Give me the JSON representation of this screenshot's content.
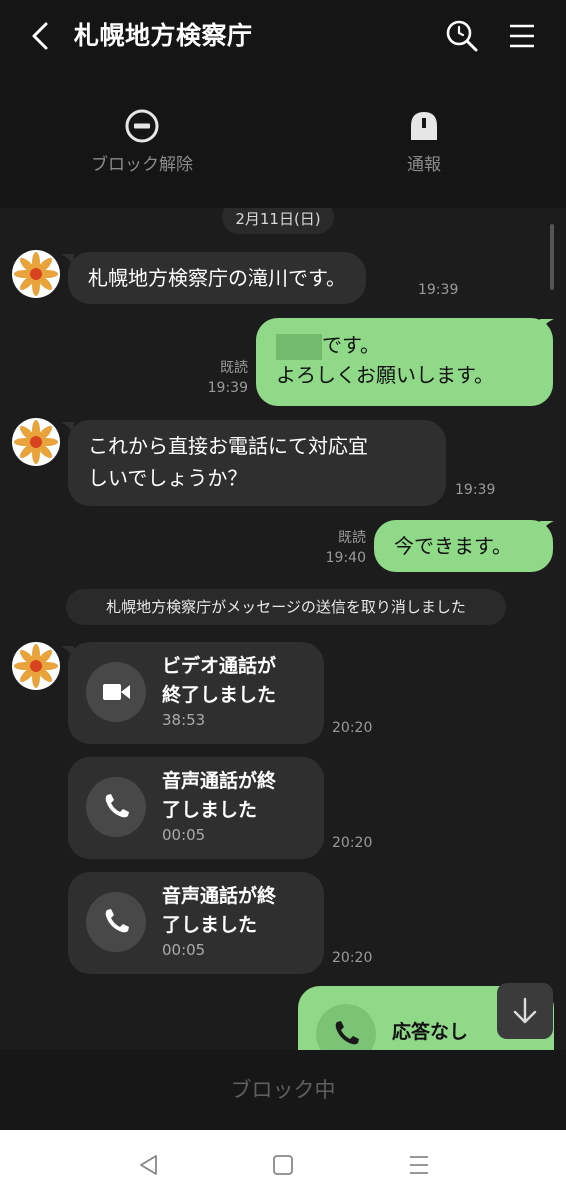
{
  "header": {
    "title": "札幌地方検察庁",
    "actions": [
      {
        "label": "ブロック解除",
        "icon": "unblock-icon"
      },
      {
        "label": "通報",
        "icon": "report-icon"
      }
    ]
  },
  "chat": {
    "date": "2月11日(日)",
    "messages": [
      {
        "side": "left",
        "text": "札幌地方検察庁の滝川です。",
        "time": "19:39"
      },
      {
        "side": "right",
        "line1": "です。",
        "line2": "よろしくお願いします。",
        "read": "既読",
        "time": "19:39"
      },
      {
        "side": "left",
        "line1": "これから直接お電話にて対応宜",
        "line2": "しいでしょうか？",
        "time": "19:39"
      },
      {
        "side": "right",
        "text": "今できます。",
        "read": "既読",
        "time": "19:40"
      }
    ],
    "notice": "札幌地方検察庁がメッセージの送信を取り消しました",
    "calls": [
      {
        "line1": "ビデオ通話が",
        "line2": "終了しました",
        "duration": "38:53",
        "time": "20:20",
        "icon": "video-icon"
      },
      {
        "line1": "音声通話が終",
        "line2": "了しました",
        "duration": "00:05",
        "time": "20:20",
        "icon": "phone-icon"
      },
      {
        "line1": "音声通話が終",
        "line2": "了しました",
        "duration": "00:05",
        "time": "20:20",
        "icon": "phone-icon"
      }
    ],
    "outgoing_call": {
      "label": "応答なし",
      "icon": "phone-icon"
    }
  },
  "footer": {
    "blocked_label": "ブロック中"
  },
  "colors": {
    "bubble_self": "#8fd988",
    "bubble_other": "#2f2f2f",
    "background": "#1c1c1c"
  }
}
